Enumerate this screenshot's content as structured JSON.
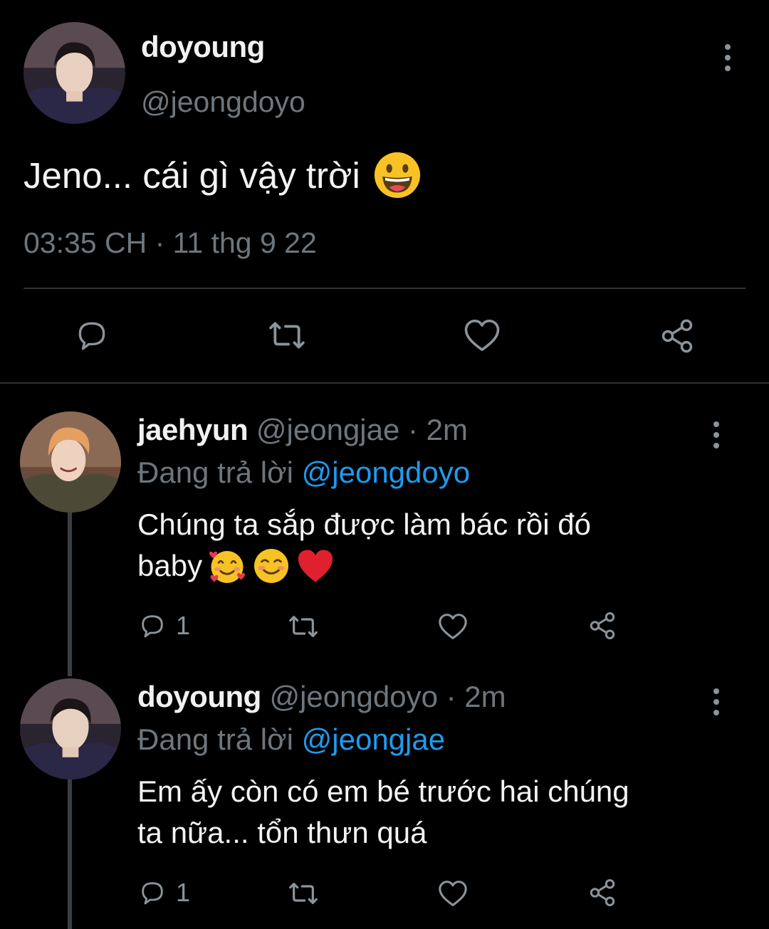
{
  "main_tweet": {
    "name": "doyoung",
    "handle": "@jeongdoyo",
    "text": "Jeno... cái gì vậy trời",
    "meta": "03:35 CH · 11 thg 9 22",
    "emoji": "grinning-face-icon"
  },
  "replies": [
    {
      "name": "jaehyun",
      "handle": "@jeongjae · 2m",
      "replying_label": "Đang trả lời",
      "replying_to": "@jeongdoyo",
      "text_line1": "Chúng ta sắp được làm bác rồi đó",
      "text_line2": "baby",
      "reply_count": "1",
      "emojis": [
        "smiling-face-with-hearts-icon",
        "smiling-face-icon",
        "red-heart-icon"
      ]
    },
    {
      "name": "doyoung",
      "handle": "@jeongdoyo · 2m",
      "replying_label": "Đang trả lời",
      "replying_to": "@jeongjae",
      "text_line1": "Em ấy còn có em bé trước hai chúng",
      "text_line2": "ta nữa... tổn thưn quá",
      "reply_count": "1"
    }
  ],
  "colors": {
    "background": "#000000",
    "text": "#e7e9ea",
    "secondary": "#6e767d",
    "mention": "#1d9bf0",
    "divider": "#2f3336"
  }
}
